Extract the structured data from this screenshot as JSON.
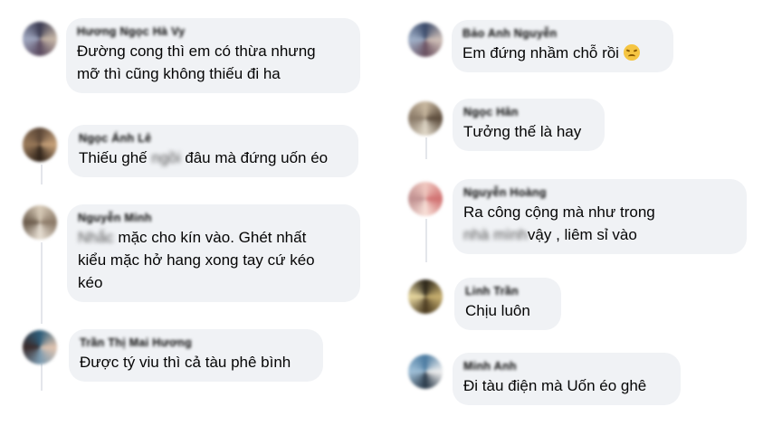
{
  "comments": [
    {
      "name": "Hương Ngọc Hà Vy",
      "lines": [
        "Đường cong thì em có thừa nhưng",
        "mỡ thì cũng không thiếu đi ha"
      ]
    },
    {
      "name": "Ngọc Ánh Lê",
      "pre": "Thiếu ghế",
      "redacted": "ngồi",
      "post": "đâu mà đứng uốn éo"
    },
    {
      "name": "Nguyễn Minh",
      "line1_redacted": "Nhắc",
      "line1_post": "mặc cho kín vào. Ghét nhất",
      "lines_rest": [
        "kiểu mặc hở hang xong tay cứ kéo",
        "kéo"
      ]
    },
    {
      "name": "Trần Thị Mai Hương",
      "lines": [
        "Được tý viu thì cả tàu phê bình"
      ]
    },
    {
      "name": "Bảo Anh Nguyễn",
      "text": "Em đứng nhầm chỗ rồi",
      "emoji": "tired-face"
    },
    {
      "name": "Ngọc Hân",
      "lines": [
        "Tưởng thế là hay"
      ]
    },
    {
      "name": "Nguyễn Hoàng",
      "lines": [
        "Ra công cộng mà như trong"
      ],
      "line2_redacted": "nhà mình",
      "line2_post": "vậy , liêm sỉ vào"
    },
    {
      "name": "Linh Trần",
      "lines": [
        "Chịu luôn"
      ]
    },
    {
      "name": "Minh Anh",
      "lines": [
        "Đi tàu điện mà Uốn éo ghê"
      ]
    }
  ]
}
